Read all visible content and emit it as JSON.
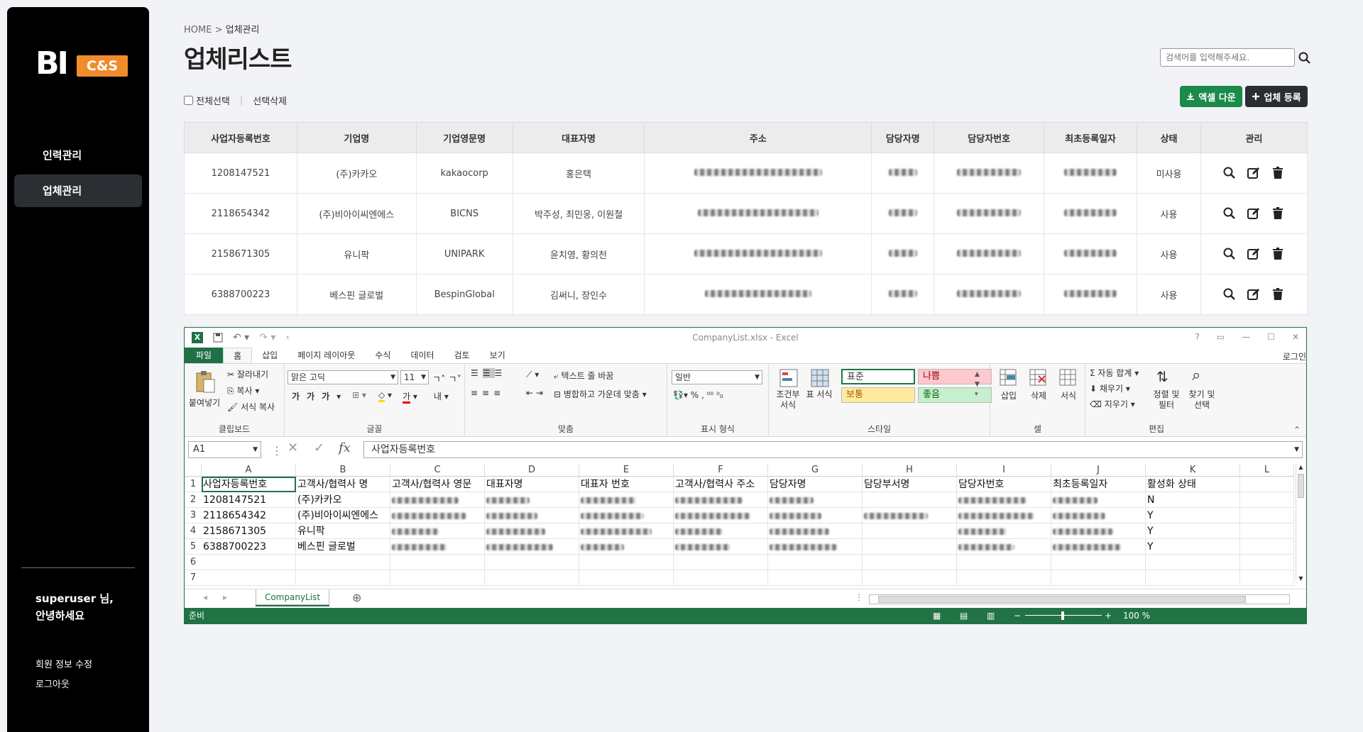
{
  "sidebar": {
    "logo_text": "BI",
    "logo_sub": "C&S",
    "items": [
      {
        "label": "인력관리",
        "active": false
      },
      {
        "label": "업체관리",
        "active": true
      }
    ],
    "greeting_line1": "superuser 님,",
    "greeting_line2": "안녕하세요",
    "edit_profile": "회원 정보 수정",
    "logout": "로그아웃"
  },
  "header": {
    "breadcrumb_home": "HOME",
    "breadcrumb_sep": " > ",
    "breadcrumb_current": "업체관리",
    "title": "업체리스트",
    "search_placeholder": "검색어를 입력해주세요."
  },
  "toolbar": {
    "select_all": "전체선택",
    "delete_selected": "선택삭제",
    "excel_download": "엑셀 다운",
    "add_company": "업체 등록"
  },
  "table": {
    "columns": [
      "사업자등록번호",
      "기업명",
      "기업영문명",
      "대표자명",
      "주소",
      "담당자명",
      "담당자번호",
      "최초등록일자",
      "상태",
      "관리"
    ],
    "rows": [
      {
        "bizno": "1208147521",
        "name": "(주)카카오",
        "eng": "kakaocorp",
        "ceo": "홍은택",
        "status": "미사용"
      },
      {
        "bizno": "2118654342",
        "name": "(주)비아이씨엔에스",
        "eng": "BICNS",
        "ceo": "박주성, 최민웅, 이원철",
        "status": "사용"
      },
      {
        "bizno": "2158671305",
        "name": "유니팍",
        "eng": "UNIPARK",
        "ceo": "윤치영, 황의천",
        "status": "사용"
      },
      {
        "bizno": "6388700223",
        "name": "베스핀 글로벌",
        "eng": "BespinGlobal",
        "ceo": "김써니, 장인수",
        "status": "사용"
      }
    ]
  },
  "excel": {
    "file_title": "CompanyList.xlsx - Excel",
    "tabs": [
      "파일",
      "홈",
      "삽입",
      "페이지 레이아웃",
      "수식",
      "데이터",
      "검토",
      "보기"
    ],
    "login": "로그인",
    "clipboard": {
      "paste": "붙여넣기",
      "cut": "잘라내기",
      "copy": "복사",
      "format_painter": "서식 복사",
      "label": "클립보드"
    },
    "font": {
      "name": "맑은 고딕",
      "size": "11",
      "label": "글꼴"
    },
    "align": {
      "wrap": "텍스트 줄 바꿈",
      "merge": "병합하고 가운데 맞춤",
      "label": "맞춤"
    },
    "number": {
      "format": "일반",
      "label": "표시 형식"
    },
    "styles": {
      "cond": "조건부 서식",
      "table": "표 서식",
      "normal": "표준",
      "bad": "나쁨",
      "neutral": "보통",
      "good": "좋음",
      "label": "스타일"
    },
    "cells": {
      "insert": "삽입",
      "delete": "삭제",
      "format": "서식",
      "label": "셀"
    },
    "editing": {
      "autosum": "자동 합계",
      "fill": "채우기",
      "clear": "지우기",
      "sort": "정렬 및 필터",
      "find": "찾기 및 선택",
      "label": "편집"
    },
    "name_box": "A1",
    "formula": "사업자등록번호",
    "columns": [
      "A",
      "B",
      "C",
      "D",
      "E",
      "F",
      "G",
      "H",
      "I",
      "J",
      "K",
      "L"
    ],
    "header_row": [
      "사업자등록번호",
      "고객사/협력사 명",
      "고객사/협력사 영문",
      "대표자명",
      "대표자 번호",
      "고객사/협력사 주소",
      "담당자명",
      "담당부서명",
      "담당자번호",
      "최초등록일자",
      "활성화 상태",
      ""
    ],
    "rows": [
      {
        "a": "1208147521",
        "b": "(주)카카오",
        "k": "N"
      },
      {
        "a": "2118654342",
        "b": "(주)비아이씨엔에스",
        "k": "Y"
      },
      {
        "a": "2158671305",
        "b": "유니팍",
        "k": "Y"
      },
      {
        "a": "6388700223",
        "b": "베스핀 글로벌",
        "k": "Y"
      }
    ],
    "row_numbers": [
      "1",
      "2",
      "3",
      "4",
      "5",
      "6",
      "7"
    ],
    "sheet_name": "CompanyList",
    "status": "준비",
    "zoom": "100 %"
  }
}
